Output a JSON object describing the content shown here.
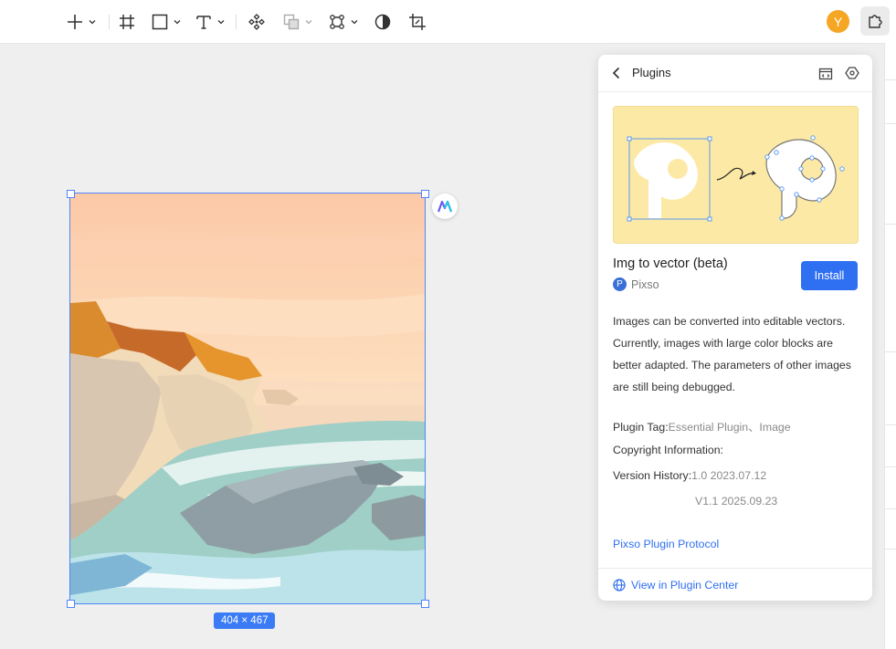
{
  "toolbar": {
    "tools": [
      "add",
      "frame",
      "shape",
      "text",
      "component",
      "boolean",
      "vector",
      "mask",
      "crop"
    ],
    "avatar_initial": "Y"
  },
  "canvas": {
    "size_label": "404 × 467",
    "selection_color": "#4f86f7"
  },
  "panel": {
    "title": "Plugins",
    "plugin": {
      "name": "Img to vector (beta)",
      "author": "Pixso",
      "author_logo": "P",
      "install_label": "Install",
      "description": "Images can be converted into editable vectors. Currently, images with large color blocks are better adapted. The parameters of other images are still being debugged.",
      "tag_label": "Plugin Tag:",
      "tag_value": "Essential Plugin、Image",
      "copyright_label": "Copyright Information:",
      "version_label": "Version History:",
      "versions": [
        "1.0 2023.07.12",
        "V1.1 2025.09.23"
      ],
      "protocol_link": "Pixso Plugin Protocol",
      "center_link": "View in Plugin Center"
    }
  },
  "colors": {
    "accent": "#2f6ff2",
    "avatar": "#f5a623"
  }
}
